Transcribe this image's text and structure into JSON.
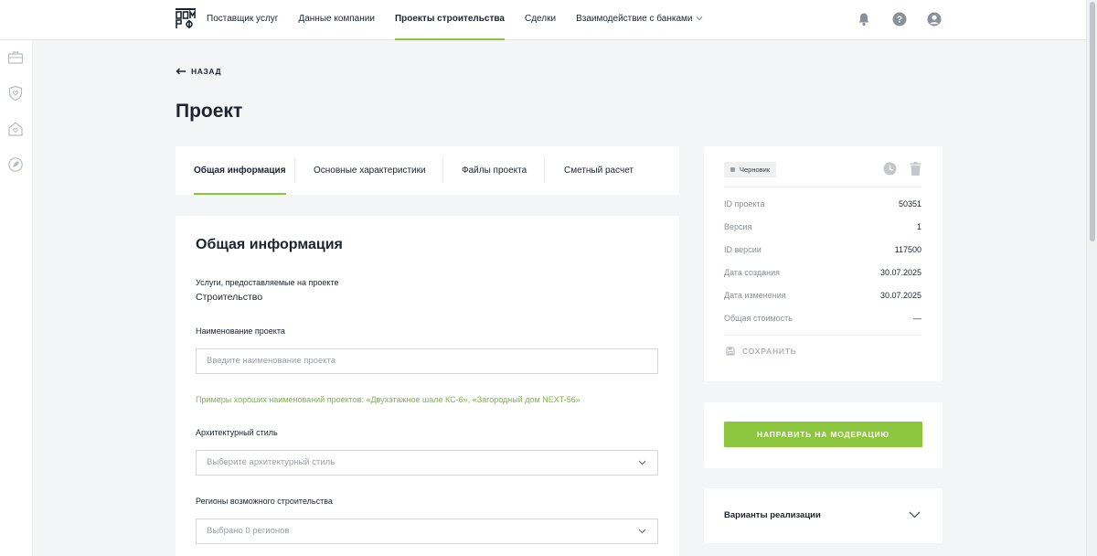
{
  "header": {
    "logo_icon": "domrf-logo-icon",
    "nav": [
      {
        "label": "Поставщик услуг"
      },
      {
        "label": "Данные компании"
      },
      {
        "label": "Проекты строительства",
        "active": true
      },
      {
        "label": "Сделки"
      },
      {
        "label": "Взаимодействие с банками",
        "has_dropdown": true
      }
    ],
    "icons": [
      "bell-icon",
      "help-icon",
      "user-icon"
    ]
  },
  "sidebar": {
    "icons": [
      "briefcase-icon",
      "shield-icon",
      "home-heart-icon",
      "rocket-icon"
    ]
  },
  "page": {
    "back_label": "НАЗАД",
    "title": "Проект"
  },
  "tabs": [
    {
      "label": "Общая информация",
      "active": true
    },
    {
      "label": "Основные характеристики"
    },
    {
      "label": "Файлы проекта"
    },
    {
      "label": "Сметный расчет"
    }
  ],
  "form": {
    "title": "Общая информация",
    "services_label": "Услуги, предоставляемые на проекте",
    "services_value": "Строительство",
    "name_label": "Наименование проекта",
    "name_placeholder": "Введите наименование проекта",
    "name_hint": "Примеры хороших наименований проектов: «Двухэтажное шале КС-6», «Загородный дом NEXT-56»",
    "style_label": "Архитектурный стиль",
    "style_placeholder": "Выберите архитектурный стиль",
    "regions_label": "Регионы возможного строительства",
    "regions_value": "Выбрано 0 регионов"
  },
  "info": {
    "status": "Черновик",
    "rows": [
      {
        "key": "ID проекта",
        "value": "50351"
      },
      {
        "key": "Версия",
        "value": "1"
      },
      {
        "key": "ID версии",
        "value": "117500"
      },
      {
        "key": "Дата создания",
        "value": "30.07.2025"
      },
      {
        "key": "Дата изменения",
        "value": "30.07.2025"
      },
      {
        "key": "Общая стоимость",
        "value": "—"
      }
    ],
    "save_label": "СОХРАНИТЬ"
  },
  "actions": {
    "moderate_label": "НАПРАВИТЬ НА МОДЕРАЦИЮ"
  },
  "variants": {
    "title": "Варианты реализации"
  },
  "colors": {
    "accent": "#8cc63f",
    "hint": "#7ab648",
    "text": "#1b2430",
    "muted": "#8a9099",
    "background": "#f4f5f6"
  }
}
